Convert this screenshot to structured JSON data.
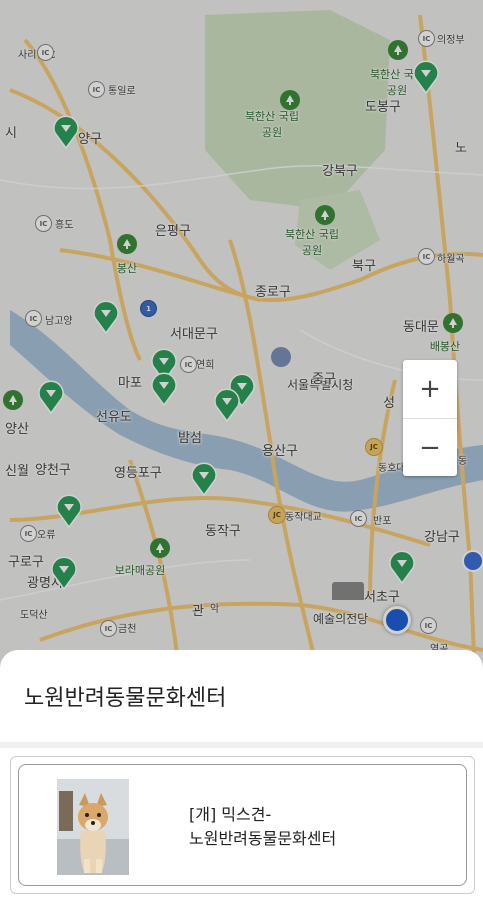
{
  "map": {
    "labels": [
      {
        "text": "사리현IC",
        "cls": "sm"
      },
      {
        "text": "통일로",
        "cls": "sm"
      },
      {
        "text": "양구",
        "cls": ""
      },
      {
        "text": "시",
        "cls": ""
      },
      {
        "text": "흥도",
        "cls": "sm"
      },
      {
        "text": "은평구",
        "cls": ""
      },
      {
        "text": "봉산",
        "cls": "green"
      },
      {
        "text": "남고양",
        "cls": "sm"
      },
      {
        "text": "서대문구",
        "cls": ""
      },
      {
        "text": "종로구",
        "cls": ""
      },
      {
        "text": "마포",
        "cls": ""
      },
      {
        "text": "연희",
        "cls": "sm"
      },
      {
        "text": "서울특별시청",
        "cls": "md"
      },
      {
        "text": "중구",
        "cls": ""
      },
      {
        "text": "선유도",
        "cls": ""
      },
      {
        "text": "밤섬",
        "cls": ""
      },
      {
        "text": "용산구",
        "cls": ""
      },
      {
        "text": "성",
        "cls": ""
      },
      {
        "text": "신월",
        "cls": ""
      },
      {
        "text": "양천구",
        "cls": ""
      },
      {
        "text": "영등포구",
        "cls": ""
      },
      {
        "text": "동호대교",
        "cls": "sm"
      },
      {
        "text": "동작대교",
        "cls": "sm"
      },
      {
        "text": "반포",
        "cls": "sm"
      },
      {
        "text": "오류",
        "cls": "sm"
      },
      {
        "text": "동작구",
        "cls": ""
      },
      {
        "text": "강남구",
        "cls": ""
      },
      {
        "text": "구로구",
        "cls": ""
      },
      {
        "text": "보라매공원",
        "cls": "green"
      },
      {
        "text": "광명시",
        "cls": ""
      },
      {
        "text": "관",
        "cls": ""
      },
      {
        "text": "악",
        "cls": "sm"
      },
      {
        "text": "서초구",
        "cls": ""
      },
      {
        "text": "예술의전당",
        "cls": "md"
      },
      {
        "text": "도덕산",
        "cls": "sm"
      },
      {
        "text": "금천",
        "cls": "sm"
      },
      {
        "text": "의정부",
        "cls": "sm"
      },
      {
        "text": "도봉구",
        "cls": ""
      },
      {
        "text": "북한산 국립공원",
        "cls": "green"
      },
      {
        "text": "북한산 국립공원",
        "cls": "green"
      },
      {
        "text": "북한산 국립공원",
        "cls": "green"
      },
      {
        "text": "강북구",
        "cls": ""
      },
      {
        "text": "노",
        "cls": ""
      },
      {
        "text": "북구",
        "cls": ""
      },
      {
        "text": "하월곡",
        "cls": "sm"
      },
      {
        "text": "동대문",
        "cls": ""
      },
      {
        "text": "배봉산",
        "cls": "green"
      },
      {
        "text": "양산",
        "cls": ""
      },
      {
        "text": "염곡",
        "cls": "sm"
      },
      {
        "text": "동",
        "cls": "sm"
      }
    ],
    "ic_badge": "IC",
    "jc_badge": "JC",
    "route_badge": "1"
  },
  "zoom": {
    "in_label": "+",
    "out_label": "−"
  },
  "sheet": {
    "title": "노원반려동물문화센터",
    "card": {
      "line1": "[개] 믹스견-",
      "line2": "노원반려동물문화센터"
    }
  },
  "colors": {
    "pin": "#2e9e5b",
    "road": "#f5c977",
    "water": "#a8c3d8",
    "park": "#cfe0c3"
  }
}
